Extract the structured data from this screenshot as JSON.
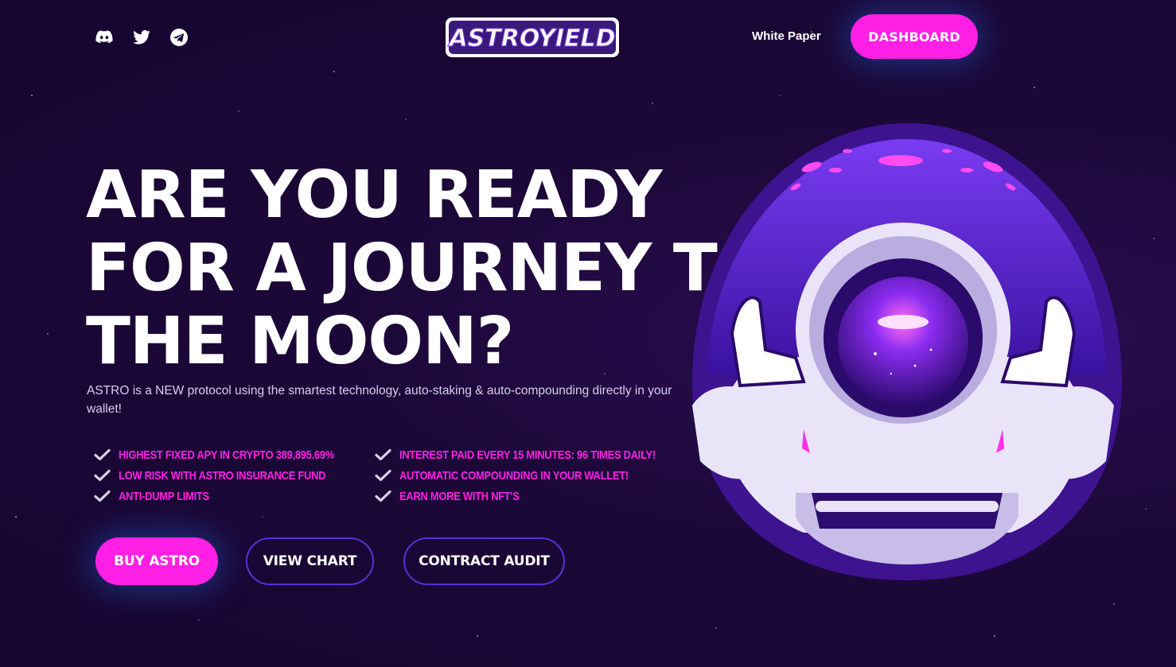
{
  "header": {
    "social": [
      {
        "name": "discord-icon"
      },
      {
        "name": "twitter-icon"
      },
      {
        "name": "telegram-icon"
      }
    ],
    "logo_text": "ASTROYIELD",
    "white_paper_label": "White Paper",
    "dashboard_label": "DASHBOARD"
  },
  "hero": {
    "headline": [
      "ARE YOU READY",
      "FOR A JOURNEY TO",
      "THE MOON?"
    ],
    "subtitle": "ASTRO is a NEW protocol using the smartest technology, auto-staking & auto-compounding directly in your wallet!",
    "features": [
      "HIGHEST FIXED APY IN CRYPTO 389,895.69%",
      "INTEREST PAID EVERY 15 MINUTES: 96 TIMES DAILY!",
      "LOW RISK WITH ASTRO INSURANCE FUND",
      "AUTOMATIC COMPOUNDING IN YOUR WALLET!",
      "ANTI-DUMP LIMITS",
      "EARN MORE WITH NFT'S"
    ],
    "buttons": {
      "buy": "BUY ASTRO",
      "chart": "VIEW CHART",
      "audit": "CONTRACT AUDIT"
    }
  },
  "colors": {
    "background": "#1a0733",
    "accent_pink": "#ff1fe5",
    "outline_purple": "#5a2fd6",
    "text_white": "#ffffff"
  }
}
